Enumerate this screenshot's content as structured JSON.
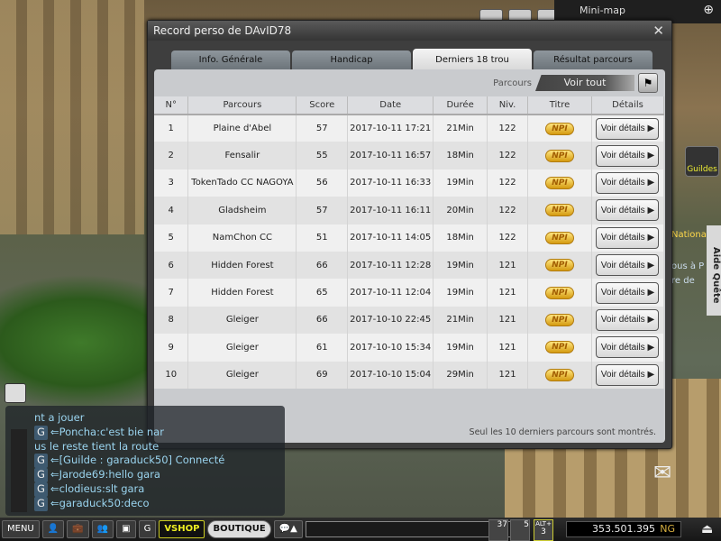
{
  "minimap": {
    "title": "Mini-map"
  },
  "side": {
    "guildes": "Guildes",
    "aide_quete": "Aide Quête",
    "quest_line": "Nationa..",
    "quest_line2": "ous à P",
    "quest_line3": "re de"
  },
  "dialog": {
    "title": "Record perso de DAvID78",
    "tabs": [
      "Info. Générale",
      "Handicap",
      "Derniers 18 trou",
      "Résultat parcours"
    ],
    "active_tab": 2,
    "filter_label": "Parcours",
    "filter_value": "Voir tout",
    "columns": [
      "N°",
      "Parcours",
      "Score",
      "Date",
      "Durée",
      "Niv.",
      "Titre",
      "Détails"
    ],
    "rows": [
      [
        "1",
        "Plaine d'Abel",
        "57",
        "2017-10-11 17:21",
        "21Min",
        "122"
      ],
      [
        "2",
        "Fensalir",
        "55",
        "2017-10-11 16:57",
        "18Min",
        "122"
      ],
      [
        "3",
        "TokenTado CC NAGOYA",
        "56",
        "2017-10-11 16:33",
        "19Min",
        "122"
      ],
      [
        "4",
        "Gladsheim",
        "57",
        "2017-10-11 16:11",
        "20Min",
        "122"
      ],
      [
        "5",
        "NamChon CC",
        "51",
        "2017-10-11 14:05",
        "18Min",
        "122"
      ],
      [
        "6",
        "Hidden Forest",
        "66",
        "2017-10-11 12:28",
        "19Min",
        "121"
      ],
      [
        "7",
        "Hidden Forest",
        "65",
        "2017-10-11 12:04",
        "19Min",
        "121"
      ],
      [
        "8",
        "Gleiger",
        "66",
        "2017-10-10 22:45",
        "21Min",
        "121"
      ],
      [
        "9",
        "Gleiger",
        "61",
        "2017-10-10 15:34",
        "19Min",
        "121"
      ],
      [
        "10",
        "Gleiger",
        "69",
        "2017-10-10 15:04",
        "29Min",
        "121"
      ]
    ],
    "title_badge": "NPI",
    "details_label": "Voir détails ▶",
    "note": "Seul les 10 derniers parcours sont montrés."
  },
  "chat": {
    "lines": [
      {
        "g": false,
        "text": "nt a  jouer"
      },
      {
        "g": true,
        "text": "Poncha:c'est bie nar"
      },
      {
        "g": false,
        "text": "us le reste tient la route"
      },
      {
        "g": true,
        "text": "[Guilde :  garaduck50] Connecté"
      },
      {
        "g": true,
        "text": "Jarode69:hello gara"
      },
      {
        "g": true,
        "text": "clodieus:slt gara"
      },
      {
        "g": true,
        "text": "garaduck50:deco"
      }
    ]
  },
  "bottombar": {
    "menu": "MENU",
    "g": "G",
    "vshop": "VSHOP",
    "boutique": "BOUTIQUE",
    "item1_count": "37",
    "item2_count": "5",
    "alt_label": "ALT+",
    "alt_value": "3",
    "money": "353.501.395",
    "currency": "NG"
  }
}
